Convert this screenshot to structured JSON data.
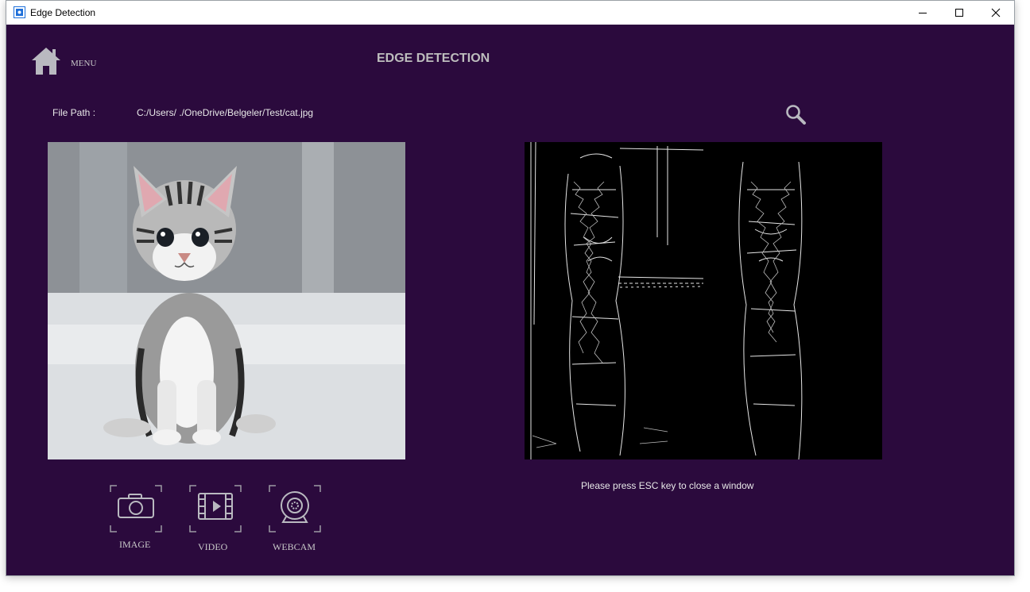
{
  "window": {
    "title": "Edge Detection",
    "minimize": "minimize",
    "maximize": "maximize",
    "close": "close"
  },
  "header": {
    "menu_label": "MENU",
    "title": "EDGE DETECTION"
  },
  "file": {
    "label": "File Path :",
    "path": "C:/Users/     ./OneDrive/Belgeler/Test/cat.jpg"
  },
  "status": {
    "esc_note": "Please press ESC key to close a window"
  },
  "modes": [
    {
      "label": "IMAGE",
      "icon": "camera-icon"
    },
    {
      "label": "VIDEO",
      "icon": "video-icon"
    },
    {
      "label": "WEBCAM",
      "icon": "webcam-icon"
    }
  ],
  "colors": {
    "background": "#2b0a3d",
    "title_text": "#bdbdbd",
    "icon": "#b9b9c0"
  }
}
